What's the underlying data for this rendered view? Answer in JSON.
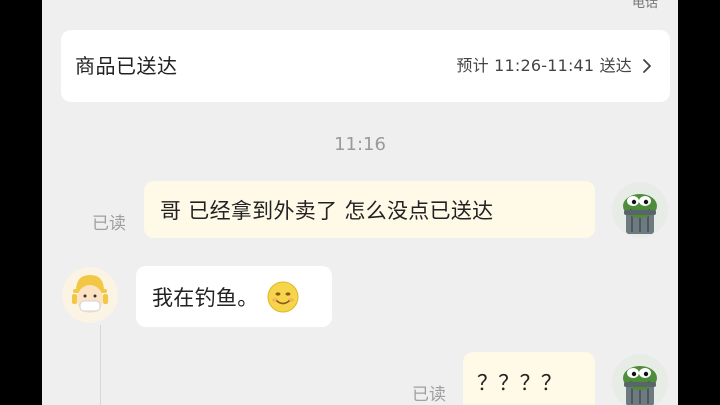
{
  "header": {
    "cutoff_text": "电话"
  },
  "delivery_card": {
    "title": "商品已送达",
    "eta": "预计 11:26-11:41 送达"
  },
  "chat": {
    "timestamp": "11:16",
    "messages": [
      {
        "direction": "outgoing",
        "text": "哥 已经拿到外卖了 怎么没点已送达",
        "read_status": "已读"
      },
      {
        "direction": "incoming",
        "text": "我在钓鱼。",
        "emoji": "smiling-face"
      },
      {
        "direction": "outgoing",
        "text": "？？？？",
        "read_status": "已读"
      }
    ]
  },
  "colors": {
    "page_bg": "#efeff0",
    "card_bg": "#ffffff",
    "outgoing_bubble": "#fff9e8",
    "incoming_bubble": "#ffffff",
    "muted_text": "#a0a0a0"
  }
}
